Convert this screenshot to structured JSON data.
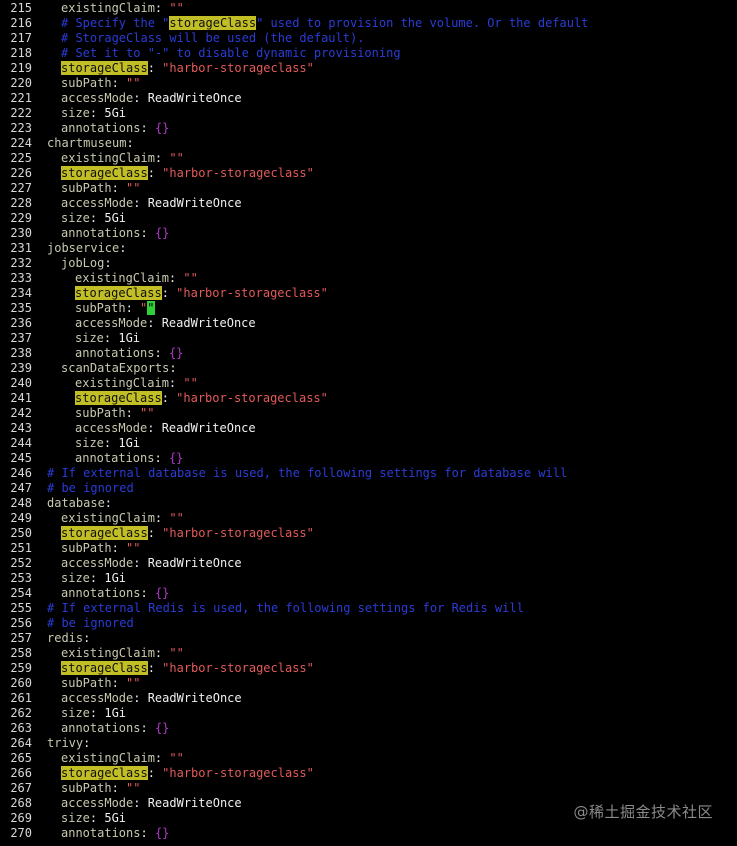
{
  "colors": {
    "background": "#000000",
    "key": "#c9c8b0",
    "search_highlight_bg": "#c2be25",
    "string": "#e25a5a",
    "comment": "#2b3cd6",
    "brace": "#b038c8",
    "cursor": "#2fd03a"
  },
  "watermark": "@稀土掘金技术社区",
  "lines": [
    {
      "n": "215",
      "i": 2,
      "seg": [
        [
          "k",
          "existingClaim"
        ],
        [
          "p",
          ": "
        ],
        [
          "s",
          "\"\""
        ]
      ]
    },
    {
      "n": "216",
      "i": 2,
      "seg": [
        [
          "c",
          "# Specify the \""
        ],
        [
          "hl",
          "storageClass"
        ],
        [
          "c",
          "\" used to provision the volume. Or the default"
        ]
      ]
    },
    {
      "n": "217",
      "i": 2,
      "seg": [
        [
          "c",
          "# StorageClass will be used (the default)."
        ]
      ]
    },
    {
      "n": "218",
      "i": 2,
      "seg": [
        [
          "c",
          "# Set it to \"-\" to disable dynamic provisioning"
        ]
      ]
    },
    {
      "n": "219",
      "i": 2,
      "seg": [
        [
          "hl",
          "storageClass"
        ],
        [
          "p",
          ": "
        ],
        [
          "s",
          "\"harbor-storageclass\""
        ]
      ]
    },
    {
      "n": "220",
      "i": 2,
      "seg": [
        [
          "k",
          "subPath"
        ],
        [
          "p",
          ": "
        ],
        [
          "s",
          "\"\""
        ]
      ]
    },
    {
      "n": "221",
      "i": 2,
      "seg": [
        [
          "k",
          "accessMode"
        ],
        [
          "p",
          ": "
        ],
        [
          "v",
          "ReadWriteOnce"
        ]
      ]
    },
    {
      "n": "222",
      "i": 2,
      "seg": [
        [
          "k",
          "size"
        ],
        [
          "p",
          ": "
        ],
        [
          "v",
          "5Gi"
        ]
      ]
    },
    {
      "n": "223",
      "i": 2,
      "seg": [
        [
          "k",
          "annotations"
        ],
        [
          "p",
          ": "
        ],
        [
          "b",
          "{}"
        ]
      ]
    },
    {
      "n": "224",
      "i": 1,
      "seg": [
        [
          "k",
          "chartmuseum"
        ],
        [
          "p",
          ":"
        ]
      ]
    },
    {
      "n": "225",
      "i": 2,
      "seg": [
        [
          "k",
          "existingClaim"
        ],
        [
          "p",
          ": "
        ],
        [
          "s",
          "\"\""
        ]
      ]
    },
    {
      "n": "226",
      "i": 2,
      "seg": [
        [
          "hl",
          "storageClass"
        ],
        [
          "p",
          ": "
        ],
        [
          "s",
          "\"harbor-storageclass\""
        ]
      ]
    },
    {
      "n": "227",
      "i": 2,
      "seg": [
        [
          "k",
          "subPath"
        ],
        [
          "p",
          ": "
        ],
        [
          "s",
          "\"\""
        ]
      ]
    },
    {
      "n": "228",
      "i": 2,
      "seg": [
        [
          "k",
          "accessMode"
        ],
        [
          "p",
          ": "
        ],
        [
          "v",
          "ReadWriteOnce"
        ]
      ]
    },
    {
      "n": "229",
      "i": 2,
      "seg": [
        [
          "k",
          "size"
        ],
        [
          "p",
          ": "
        ],
        [
          "v",
          "5Gi"
        ]
      ]
    },
    {
      "n": "230",
      "i": 2,
      "seg": [
        [
          "k",
          "annotations"
        ],
        [
          "p",
          ": "
        ],
        [
          "b",
          "{}"
        ]
      ]
    },
    {
      "n": "231",
      "i": 1,
      "seg": [
        [
          "k",
          "jobservice"
        ],
        [
          "p",
          ":"
        ]
      ]
    },
    {
      "n": "232",
      "i": 2,
      "seg": [
        [
          "k",
          "jobLog"
        ],
        [
          "p",
          ":"
        ]
      ]
    },
    {
      "n": "233",
      "i": 3,
      "seg": [
        [
          "k",
          "existingClaim"
        ],
        [
          "p",
          ": "
        ],
        [
          "s",
          "\"\""
        ]
      ]
    },
    {
      "n": "234",
      "i": 3,
      "seg": [
        [
          "hl",
          "storageClass"
        ],
        [
          "p",
          ": "
        ],
        [
          "s",
          "\"harbor-storageclass\""
        ]
      ]
    },
    {
      "n": "235",
      "i": 3,
      "seg": [
        [
          "k",
          "subPath"
        ],
        [
          "p",
          ": "
        ],
        [
          "s",
          "\""
        ],
        [
          "cur",
          "\""
        ]
      ]
    },
    {
      "n": "236",
      "i": 3,
      "seg": [
        [
          "k",
          "accessMode"
        ],
        [
          "p",
          ": "
        ],
        [
          "v",
          "ReadWriteOnce"
        ]
      ]
    },
    {
      "n": "237",
      "i": 3,
      "seg": [
        [
          "k",
          "size"
        ],
        [
          "p",
          ": "
        ],
        [
          "v",
          "1Gi"
        ]
      ]
    },
    {
      "n": "238",
      "i": 3,
      "seg": [
        [
          "k",
          "annotations"
        ],
        [
          "p",
          ": "
        ],
        [
          "b",
          "{}"
        ]
      ]
    },
    {
      "n": "239",
      "i": 2,
      "seg": [
        [
          "k",
          "scanDataExports"
        ],
        [
          "p",
          ":"
        ]
      ]
    },
    {
      "n": "240",
      "i": 3,
      "seg": [
        [
          "k",
          "existingClaim"
        ],
        [
          "p",
          ": "
        ],
        [
          "s",
          "\"\""
        ]
      ]
    },
    {
      "n": "241",
      "i": 3,
      "seg": [
        [
          "hl",
          "storageClass"
        ],
        [
          "p",
          ": "
        ],
        [
          "s",
          "\"harbor-storageclass\""
        ]
      ]
    },
    {
      "n": "242",
      "i": 3,
      "seg": [
        [
          "k",
          "subPath"
        ],
        [
          "p",
          ": "
        ],
        [
          "s",
          "\"\""
        ]
      ]
    },
    {
      "n": "243",
      "i": 3,
      "seg": [
        [
          "k",
          "accessMode"
        ],
        [
          "p",
          ": "
        ],
        [
          "v",
          "ReadWriteOnce"
        ]
      ]
    },
    {
      "n": "244",
      "i": 3,
      "seg": [
        [
          "k",
          "size"
        ],
        [
          "p",
          ": "
        ],
        [
          "v",
          "1Gi"
        ]
      ]
    },
    {
      "n": "245",
      "i": 3,
      "seg": [
        [
          "k",
          "annotations"
        ],
        [
          "p",
          ": "
        ],
        [
          "b",
          "{}"
        ]
      ]
    },
    {
      "n": "246",
      "i": 1,
      "seg": [
        [
          "c",
          "# If external database is used, the following settings for database will"
        ]
      ]
    },
    {
      "n": "247",
      "i": 1,
      "seg": [
        [
          "c",
          "# be ignored"
        ]
      ]
    },
    {
      "n": "248",
      "i": 1,
      "seg": [
        [
          "k",
          "database"
        ],
        [
          "p",
          ":"
        ]
      ]
    },
    {
      "n": "249",
      "i": 2,
      "seg": [
        [
          "k",
          "existingClaim"
        ],
        [
          "p",
          ": "
        ],
        [
          "s",
          "\"\""
        ]
      ]
    },
    {
      "n": "250",
      "i": 2,
      "seg": [
        [
          "hl",
          "storageClass"
        ],
        [
          "p",
          ": "
        ],
        [
          "s",
          "\"harbor-storageclass\""
        ]
      ]
    },
    {
      "n": "251",
      "i": 2,
      "seg": [
        [
          "k",
          "subPath"
        ],
        [
          "p",
          ": "
        ],
        [
          "s",
          "\"\""
        ]
      ]
    },
    {
      "n": "252",
      "i": 2,
      "seg": [
        [
          "k",
          "accessMode"
        ],
        [
          "p",
          ": "
        ],
        [
          "v",
          "ReadWriteOnce"
        ]
      ]
    },
    {
      "n": "253",
      "i": 2,
      "seg": [
        [
          "k",
          "size"
        ],
        [
          "p",
          ": "
        ],
        [
          "v",
          "1Gi"
        ]
      ]
    },
    {
      "n": "254",
      "i": 2,
      "seg": [
        [
          "k",
          "annotations"
        ],
        [
          "p",
          ": "
        ],
        [
          "b",
          "{}"
        ]
      ]
    },
    {
      "n": "255",
      "i": 1,
      "seg": [
        [
          "c",
          "# If external Redis is used, the following settings for Redis will"
        ]
      ]
    },
    {
      "n": "256",
      "i": 1,
      "seg": [
        [
          "c",
          "# be ignored"
        ]
      ]
    },
    {
      "n": "257",
      "i": 1,
      "seg": [
        [
          "k",
          "redis"
        ],
        [
          "p",
          ":"
        ]
      ]
    },
    {
      "n": "258",
      "i": 2,
      "seg": [
        [
          "k",
          "existingClaim"
        ],
        [
          "p",
          ": "
        ],
        [
          "s",
          "\"\""
        ]
      ]
    },
    {
      "n": "259",
      "i": 2,
      "seg": [
        [
          "hl",
          "storageClass"
        ],
        [
          "p",
          ": "
        ],
        [
          "s",
          "\"harbor-storageclass\""
        ]
      ]
    },
    {
      "n": "260",
      "i": 2,
      "seg": [
        [
          "k",
          "subPath"
        ],
        [
          "p",
          ": "
        ],
        [
          "s",
          "\"\""
        ]
      ]
    },
    {
      "n": "261",
      "i": 2,
      "seg": [
        [
          "k",
          "accessMode"
        ],
        [
          "p",
          ": "
        ],
        [
          "v",
          "ReadWriteOnce"
        ]
      ]
    },
    {
      "n": "262",
      "i": 2,
      "seg": [
        [
          "k",
          "size"
        ],
        [
          "p",
          ": "
        ],
        [
          "v",
          "1Gi"
        ]
      ]
    },
    {
      "n": "263",
      "i": 2,
      "seg": [
        [
          "k",
          "annotations"
        ],
        [
          "p",
          ": "
        ],
        [
          "b",
          "{}"
        ]
      ]
    },
    {
      "n": "264",
      "i": 1,
      "seg": [
        [
          "k",
          "trivy"
        ],
        [
          "p",
          ":"
        ]
      ]
    },
    {
      "n": "265",
      "i": 2,
      "seg": [
        [
          "k",
          "existingClaim"
        ],
        [
          "p",
          ": "
        ],
        [
          "s",
          "\"\""
        ]
      ]
    },
    {
      "n": "266",
      "i": 2,
      "seg": [
        [
          "hl",
          "storageClass"
        ],
        [
          "p",
          ": "
        ],
        [
          "s",
          "\"harbor-storageclass\""
        ]
      ]
    },
    {
      "n": "267",
      "i": 2,
      "seg": [
        [
          "k",
          "subPath"
        ],
        [
          "p",
          ": "
        ],
        [
          "s",
          "\"\""
        ]
      ]
    },
    {
      "n": "268",
      "i": 2,
      "seg": [
        [
          "k",
          "accessMode"
        ],
        [
          "p",
          ": "
        ],
        [
          "v",
          "ReadWriteOnce"
        ]
      ]
    },
    {
      "n": "269",
      "i": 2,
      "seg": [
        [
          "k",
          "size"
        ],
        [
          "p",
          ": "
        ],
        [
          "v",
          "5Gi"
        ]
      ]
    },
    {
      "n": "270",
      "i": 2,
      "seg": [
        [
          "k",
          "annotations"
        ],
        [
          "p",
          ": "
        ],
        [
          "b",
          "{}"
        ]
      ]
    }
  ]
}
